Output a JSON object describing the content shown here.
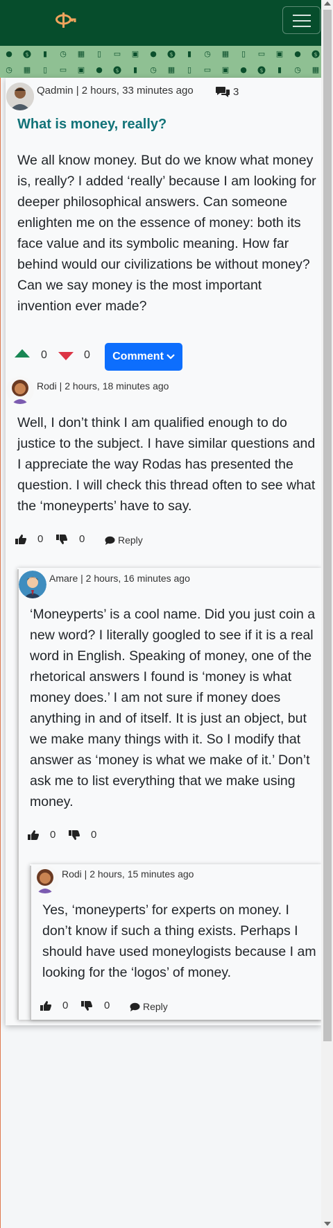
{
  "post": {
    "author": "Qadmin",
    "time": "2 hours, 33 minutes ago",
    "comment_count": "3",
    "title": "What is money, really?",
    "body": "We all know money. But do we know what money is, really? I added ‘really’ because I am looking for deeper philosophical answers. Can someone enlighten me on the essence of money: both its face value and its symbolic meaning. How far behind would our civilizations be without money? Can we say money is the most important invention ever made?",
    "upvotes": "0",
    "downvotes": "0",
    "comment_button": "Comment"
  },
  "comments": [
    {
      "author": "Rodi",
      "time": "2 hours, 18 minutes ago",
      "body": "Well, I don’t think I am qualified enough to do justice to the subject. I have similar questions and I appreciate the way Rodas has presented the question. I will check this thread often to see what the ‘moneyperts’ have to say.",
      "likes": "0",
      "dislikes": "0",
      "reply_label": "Reply"
    },
    {
      "author": "Amare",
      "time": "2 hours, 16 minutes ago",
      "body": "‘Moneyperts’ is a cool name. Did you just coin a new word? I literally googled to see if it is a real word in English. Speaking of money, one of the rhetorical answers I found is ‘money is what money does.’ I am not sure if money does anything in and of itself. It is just an object, but we make many things with it. So I modify that answer as ‘money is what we make of it.’ Don’t ask me to list everything that we make using money.",
      "likes": "0",
      "dislikes": "0"
    },
    {
      "author": "Rodi",
      "time": "2 hours, 15 minutes ago",
      "body": "Yes, ‘moneyperts’ for experts on money. I don’t know if such a thing exists. Perhaps I should have used moneylogists because I am looking for the ‘logos’ of money.",
      "likes": "0",
      "dislikes": "0",
      "reply_label": "Reply"
    }
  ],
  "colors": {
    "navbar": "#064d2c",
    "pattern": "#8fc093",
    "title": "#127378",
    "upvote": "#198754",
    "downvote": "#dc3545",
    "button": "#0d6efd"
  }
}
